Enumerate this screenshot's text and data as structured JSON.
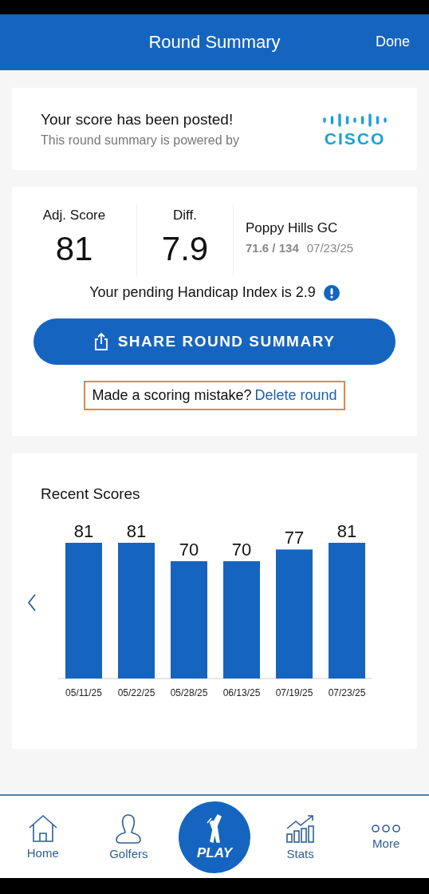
{
  "header": {
    "title": "Round Summary",
    "done": "Done"
  },
  "posted_card": {
    "title": "Your score has been posted!",
    "subtitle": "This round summary is powered by",
    "logo_text": "CISCO"
  },
  "score_card": {
    "adj_label": "Adj. Score",
    "adj_value": "81",
    "diff_label": "Diff.",
    "diff_value": "7.9",
    "course": "Poppy Hills GC",
    "rating": "71.6 / 134",
    "date": "07/23/25",
    "handicap_text": "Your pending Handicap Index is 2.9",
    "share_button": "SHARE ROUND SUMMARY",
    "mistake_text": "Made a scoring mistake?",
    "delete_link": "Delete round"
  },
  "recent_scores": {
    "title": "Recent Scores",
    "chart_data": {
      "type": "bar",
      "categories": [
        "05/11/25",
        "05/22/25",
        "05/28/25",
        "06/13/25",
        "07/19/25",
        "07/23/25"
      ],
      "values": [
        81,
        81,
        70,
        70,
        77,
        81
      ],
      "data_labels": true
    }
  },
  "nav": [
    {
      "label": "Home",
      "kind": "home",
      "selected": false
    },
    {
      "label": "Golfers",
      "kind": "golfers",
      "selected": false
    },
    {
      "label": "PLAY",
      "kind": "play",
      "selected": false
    },
    {
      "label": "Stats",
      "kind": "stats",
      "selected": false
    },
    {
      "label": "More",
      "kind": "more",
      "selected": false
    }
  ]
}
